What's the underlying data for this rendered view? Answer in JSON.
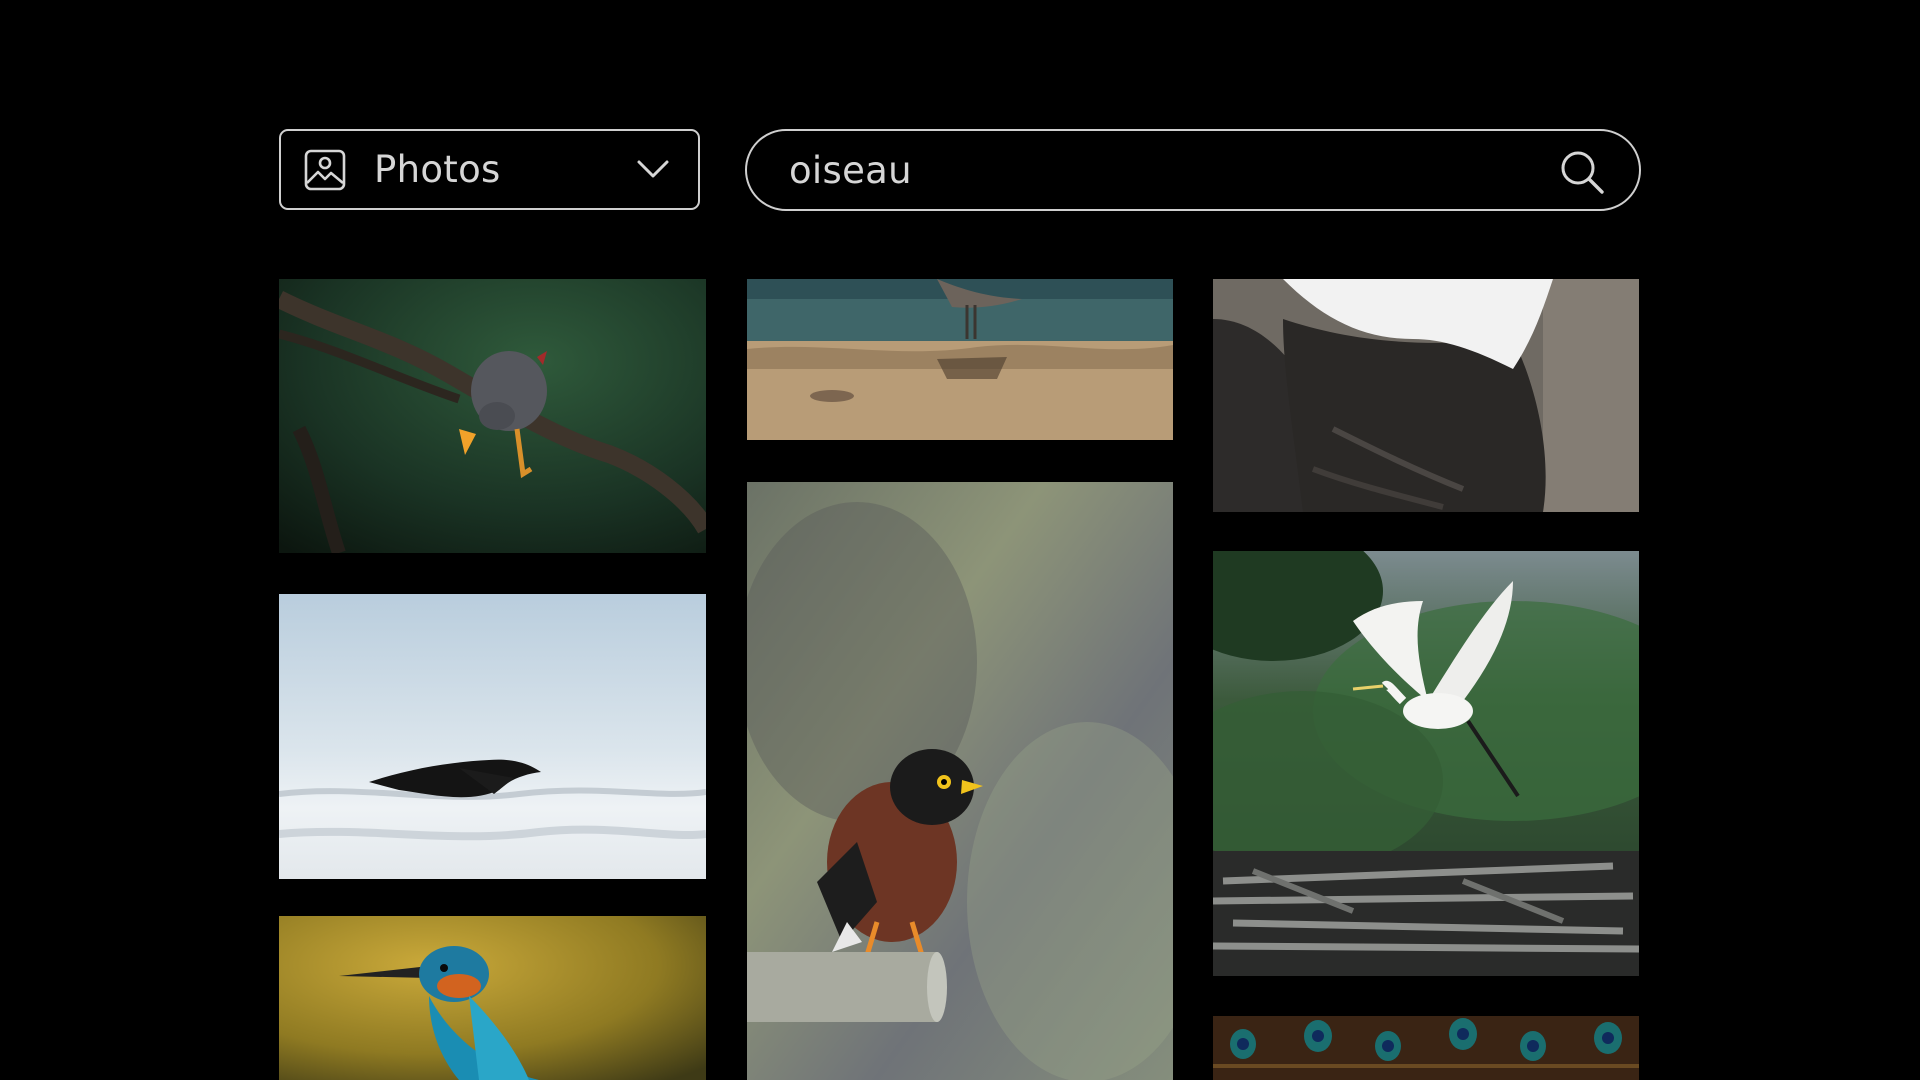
{
  "toolbar": {
    "media_type": {
      "selected": "Photos",
      "icon": "image-icon",
      "chevron_icon": "chevron-down-icon"
    },
    "search": {
      "value": "oiseau",
      "icon": "search-icon"
    }
  },
  "colors": {
    "background": "#000000",
    "control_border": "#cfcfcf",
    "control_text": "#d6d6d6"
  }
}
